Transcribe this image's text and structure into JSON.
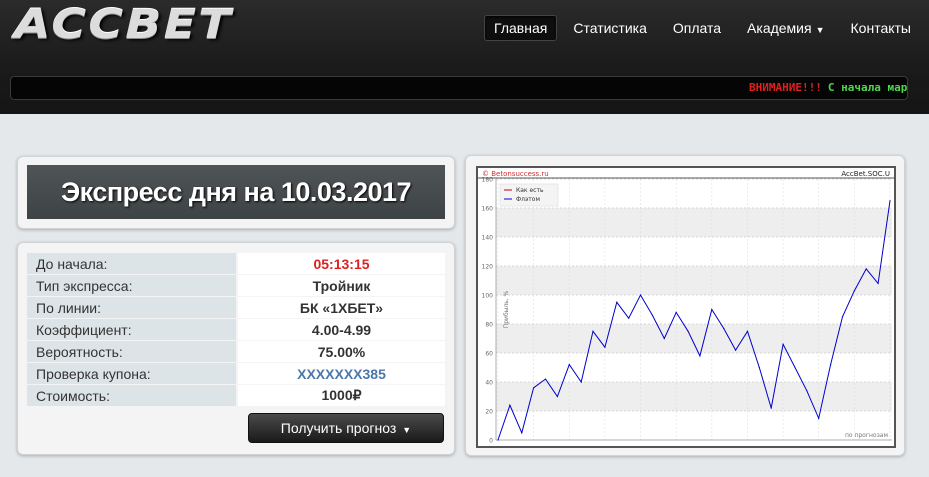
{
  "header": {
    "logo": "ACCBET",
    "nav": [
      {
        "label": "Главная",
        "active": true,
        "dropdown": false
      },
      {
        "label": "Статистика",
        "active": false,
        "dropdown": false
      },
      {
        "label": "Оплата",
        "active": false,
        "dropdown": false
      },
      {
        "label": "Академия",
        "active": false,
        "dropdown": true
      },
      {
        "label": "Контакты",
        "active": false,
        "dropdown": false
      }
    ],
    "ticker": {
      "warning": "ВНИМАНИЕ!!!",
      "message": "С начала мар"
    }
  },
  "express": {
    "title": "Экспресс дня на 10.03.2017",
    "rows": [
      {
        "label": "До начала:",
        "value": "05:13:15",
        "style": "red"
      },
      {
        "label": "Тип экспресса:",
        "value": "Тройник",
        "style": "normal"
      },
      {
        "label": "По линии:",
        "value": "БК «1XБЕТ»",
        "style": "normal"
      },
      {
        "label": "Коэффициент:",
        "value": "4.00-4.99",
        "style": "normal"
      },
      {
        "label": "Вероятность:",
        "value": "75.00%",
        "style": "normal"
      },
      {
        "label": "Проверка купона:",
        "value": "XXXXXXX385",
        "style": "blue"
      },
      {
        "label": "Стоимость:",
        "value": "1000₽",
        "style": "normal"
      }
    ],
    "button_label": "Получить прогноз"
  },
  "colors": {
    "accent_red": "#e02020",
    "ticker_green": "#4fd84f",
    "link_blue": "#4a78aa",
    "series_red": "#cc0000",
    "series_blue": "#0000cc"
  },
  "chart_data": {
    "type": "line",
    "watermark_left": "© Betonsuccess.ru",
    "watermark_right": "AccBet.SOC.U",
    "ylabel": "Прибыль, %",
    "xlabel": "по прогнозам",
    "ylim": [
      0,
      180
    ],
    "yticks": [
      0,
      20,
      40,
      60,
      80,
      100,
      120,
      140,
      160,
      180
    ],
    "legend_position": "top-left",
    "grid": true,
    "series": [
      {
        "name": "Как есть",
        "color": "#cc0000",
        "values": []
      },
      {
        "name": "Флэтом",
        "color": "#0000cc",
        "values": [
          0,
          24,
          5,
          36,
          42,
          30,
          52,
          40,
          75,
          64,
          95,
          84,
          100,
          86,
          70,
          88,
          75,
          58,
          90,
          77,
          62,
          75,
          50,
          22,
          66,
          50,
          34,
          15,
          52,
          85,
          103,
          118,
          108,
          165
        ]
      }
    ]
  }
}
